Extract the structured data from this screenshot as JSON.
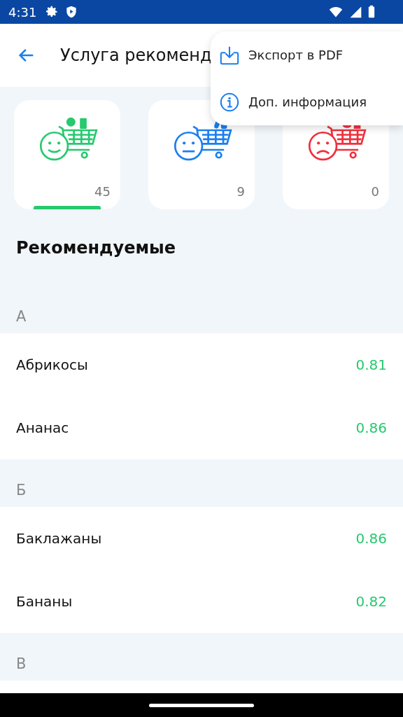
{
  "status_bar": {
    "time": "4:31"
  },
  "app_bar": {
    "title": "Услуга рекоменд"
  },
  "menu": [
    {
      "kind": "download",
      "label": "Экспорт в PDF"
    },
    {
      "kind": "info",
      "label": "Доп. информация"
    }
  ],
  "cards": [
    {
      "kind": "good",
      "color": "#27c96f",
      "count": "45",
      "selected": true
    },
    {
      "kind": "neutral",
      "color": "#1a7ff0",
      "count": "9",
      "selected": false
    },
    {
      "kind": "bad",
      "color": "#f0303e",
      "count": "0",
      "selected": false
    }
  ],
  "section_title": "Рекомендуемые",
  "groups": [
    {
      "letter": "А",
      "items": [
        {
          "name": "Абрикосы",
          "score": "0.81"
        },
        {
          "name": "Ананас",
          "score": "0.86"
        }
      ]
    },
    {
      "letter": "Б",
      "items": [
        {
          "name": "Баклажаны",
          "score": "0.86"
        },
        {
          "name": "Бананы",
          "score": "0.82"
        }
      ]
    },
    {
      "letter": "В"
    }
  ]
}
